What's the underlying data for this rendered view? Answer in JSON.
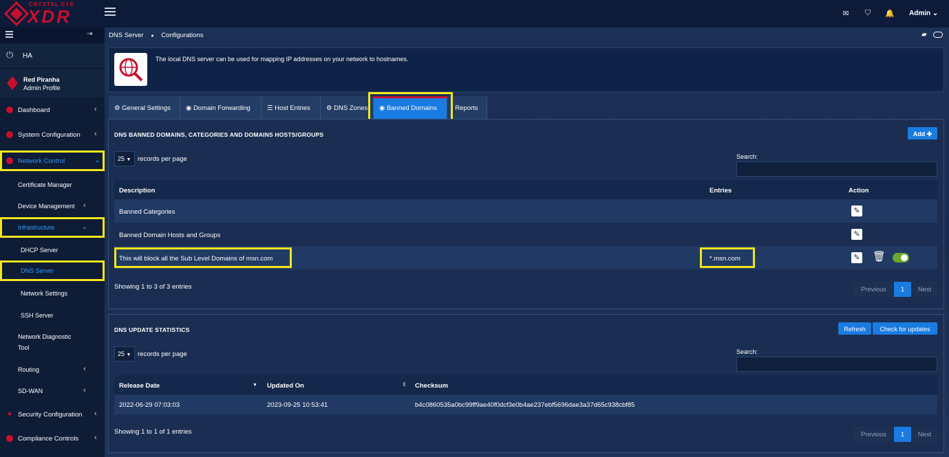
{
  "brand": {
    "small": "CRYSTAL EYE",
    "big": "XDR"
  },
  "topbar": {
    "admin": "Admin"
  },
  "sidebar": {
    "ha": "HA",
    "profile_name": "Red Piranha",
    "profile_sub": "Admin Profile",
    "items": [
      {
        "label": "Dashboard"
      },
      {
        "label": "System Configuration"
      },
      {
        "label": "Network Control"
      },
      {
        "label": "Certificate Manager"
      },
      {
        "label": "Device Management"
      },
      {
        "label": "Infrastructure"
      },
      {
        "label": "DHCP Server"
      },
      {
        "label": "DNS Server"
      },
      {
        "label": "Network Settings"
      },
      {
        "label": "SSH Server"
      },
      {
        "label": "Network Diagnostic"
      },
      {
        "label": "Tool"
      },
      {
        "label": "Routing"
      },
      {
        "label": "SD-WAN"
      },
      {
        "label": "Security Configuration"
      },
      {
        "label": "Compliance Controls"
      }
    ]
  },
  "breadcrumb": {
    "first": "DNS Server",
    "second": "Configurations"
  },
  "info": {
    "text": "The local DNS server can be used for mapping IP addresses on your network to hostnames."
  },
  "tabs": [
    "General Settings",
    "Domain Forwarding",
    "Host Entries",
    "DNS Zones",
    "Banned Domains",
    "Reports"
  ],
  "banned": {
    "title": "DNS BANNED DOMAINS, CATEGORIES AND DOMAINS HOSTS/GROUPS",
    "add": "Add",
    "per_page_value": "25",
    "per_page_label": "records per page",
    "search_label": "Search:",
    "columns": [
      "Description",
      "Entries",
      "Action"
    ],
    "rows": [
      {
        "description": "Banned Categories",
        "entries": ""
      },
      {
        "description": "Banned Domain Hosts and Groups",
        "entries": ""
      },
      {
        "description": "This will block all the Sub Level Domains of msn.com",
        "entries": "*.msn.com"
      }
    ],
    "showing": "Showing 1 to 3 of 3 entries",
    "prev": "Previous",
    "page": "1",
    "next": "Next"
  },
  "stats": {
    "title": "DNS UPDATE STATISTICS",
    "refresh": "Refresh",
    "check": "Check for updates",
    "per_page_value": "25",
    "per_page_label": "records per page",
    "search_label": "Search:",
    "columns": [
      "Release Date",
      "Updated On",
      "Checksum"
    ],
    "rows": [
      {
        "release": "2022-06-29 07:03:03",
        "updated": "2023-09-25 10:53:41",
        "checksum": "b4c0860535a0bc99ff9ae40f0dcf3e0b4ae237ebf5696dae3a37d65c938cbf85"
      }
    ],
    "showing": "Showing 1 to 1 of 1 entries",
    "prev": "Previous",
    "page": "1",
    "next": "Next"
  }
}
